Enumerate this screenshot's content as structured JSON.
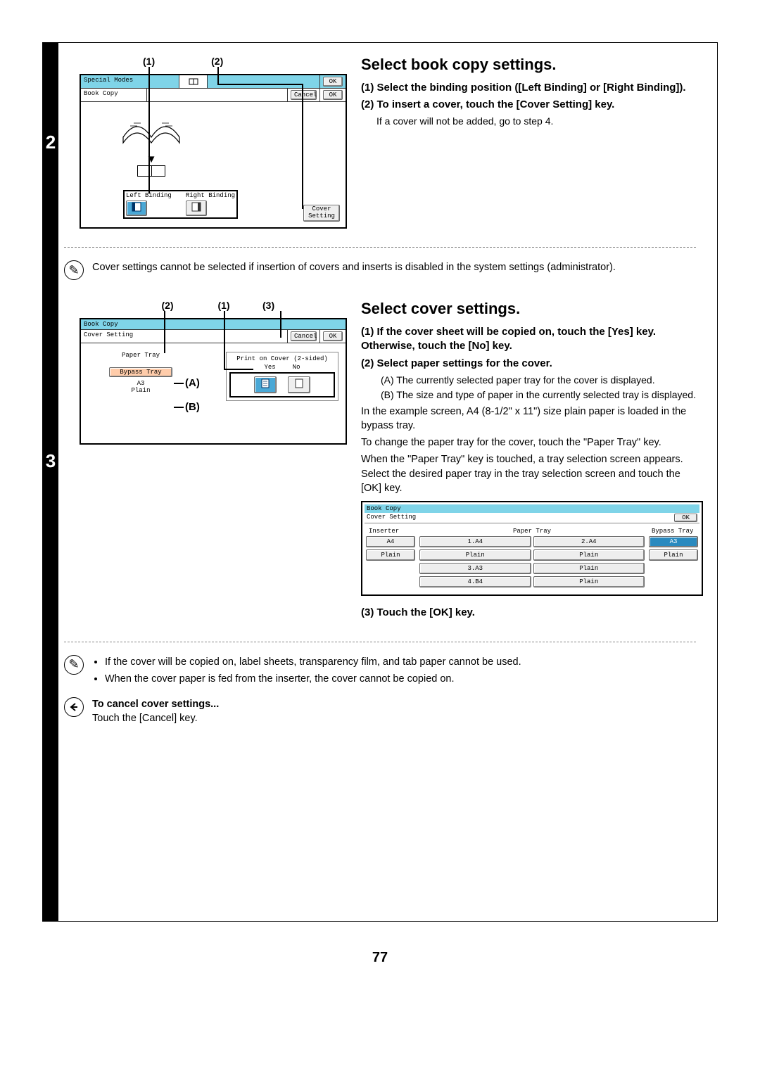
{
  "page_number": "77",
  "step2": {
    "number": "2",
    "title": "Select book copy settings.",
    "sub1": "(1) Select the binding position ([Left Binding] or [Right Binding]).",
    "sub2": "(2) To insert a cover, touch the [Cover Setting] key.",
    "note": "If a cover will not be added, go to step 4.",
    "callouts": {
      "c1": "(1)",
      "c2": "(2)"
    },
    "screen": {
      "special_modes": "Special Modes",
      "book_copy": "Book Copy",
      "ok": "OK",
      "cancel": "Cancel",
      "left_binding": "Left Binding",
      "right_binding": "Right Binding",
      "cover_setting": "Cover Setting"
    },
    "footnote": "Cover settings cannot be selected if insertion of covers and inserts is disabled in the system settings (administrator)."
  },
  "step3": {
    "number": "3",
    "title": "Select cover settings.",
    "sub1": "(1) If the cover sheet will be copied on, touch the [Yes] key. Otherwise, touch the [No] key.",
    "sub2": "(2) Select paper settings for the cover.",
    "subA": "(A) The currently selected paper tray for the cover is displayed.",
    "subB": "(B) The size and type of paper in the currently selected tray is displayed.",
    "para1": "In the example screen, A4 (8-1/2\" x 11\") size plain paper is loaded in the bypass tray.",
    "para2": "To change the paper tray for the cover, touch the \"Paper Tray\" key.",
    "para3": "When the \"Paper Tray\" key is touched, a tray selection screen appears. Select the desired paper tray in the tray selection screen and touch the [OK] key.",
    "sub3": "(3) Touch the [OK] key.",
    "callouts": {
      "c1": "(1)",
      "c2": "(2)",
      "c3": "(3)",
      "ca": "(A)",
      "cb": "(B)"
    },
    "screen1": {
      "book_copy": "Book Copy",
      "cover_setting": "Cover Setting",
      "cancel": "Cancel",
      "ok": "OK",
      "paper_tray": "Paper Tray",
      "print_on_cover": "Print on Cover (2-sided)",
      "yes": "Yes",
      "no": "No",
      "bypass_tray": "Bypass Tray",
      "a3": "A3",
      "plain": "Plain"
    },
    "screen2": {
      "book_copy": "Book Copy",
      "cover_setting": "Cover Setting",
      "ok": "OK",
      "inserter": "Inserter",
      "paper_tray": "Paper Tray",
      "bypass_tray": "Bypass Tray",
      "a4": "A4",
      "plain": "Plain",
      "t1": "1.A4",
      "t2": "2.A4",
      "t3": "3.A3",
      "t4": "4.B4",
      "bt": "A3"
    },
    "foot_b1": "If the cover will be copied on, label sheets, transparency film, and tab paper cannot be used.",
    "foot_b2": "When the cover paper is fed from the inserter, the cover cannot be copied on.",
    "cancel_title": "To cancel cover settings...",
    "cancel_body": "Touch the [Cancel] key."
  }
}
